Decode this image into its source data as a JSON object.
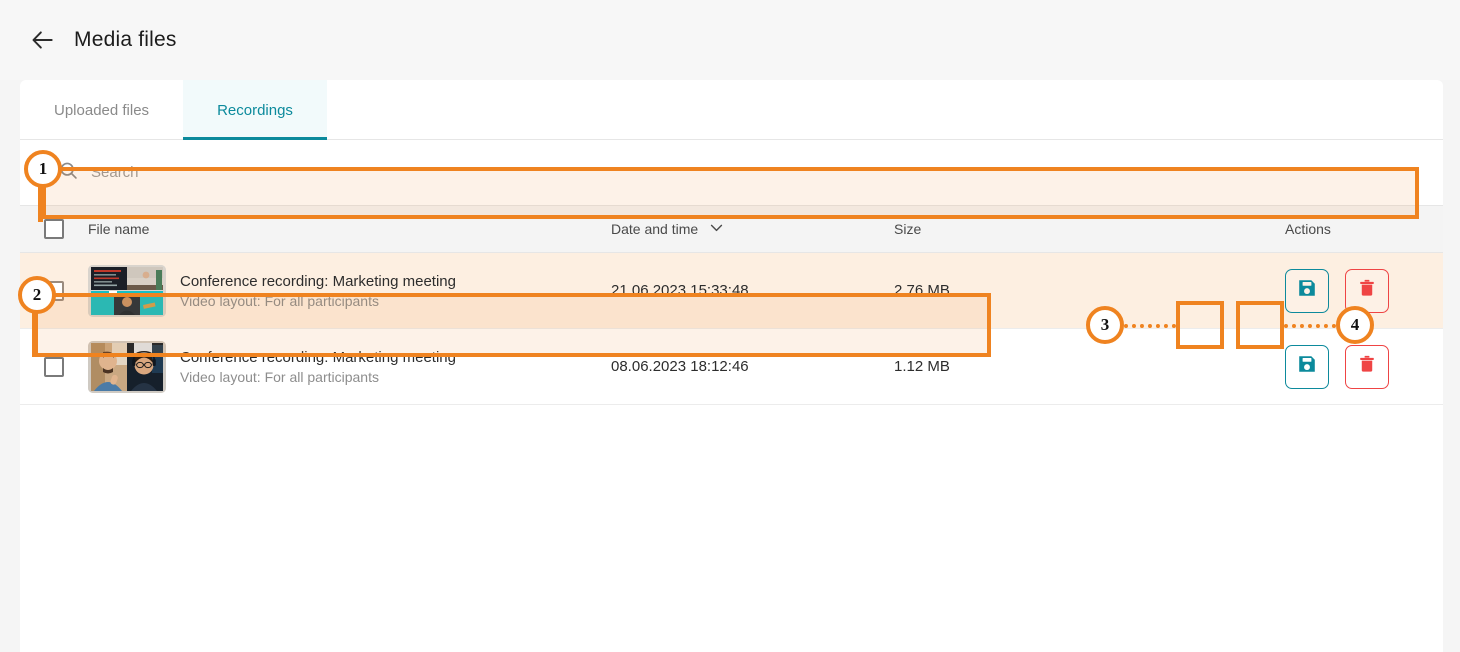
{
  "header": {
    "back_icon": "arrow-left-icon",
    "title": "Media files"
  },
  "tabs": [
    {
      "label": "Uploaded files",
      "active": false
    },
    {
      "label": "Recordings",
      "active": true
    }
  ],
  "search": {
    "icon": "search-icon",
    "placeholder": "Search",
    "value": ""
  },
  "table": {
    "columns": {
      "file_name": "File name",
      "date_time": "Date and time",
      "size": "Size",
      "actions": "Actions"
    },
    "sort_icon": "chevron-down-icon",
    "rows": [
      {
        "title": "Conference recording: Marketing meeting",
        "subtitle": "Video layout: For all participants",
        "date": "21.06.2023 15:33:48",
        "size": "2.76 MB",
        "thumbnail": "video-grid-thumbnail",
        "save_icon": "floppy-disk-save-icon",
        "delete_icon": "trash-delete-icon",
        "highlighted": true
      },
      {
        "title": "Conference recording: Marketing meeting",
        "subtitle": "Video layout: For all participants",
        "date": "08.06.2023 18:12:46",
        "size": "1.12 MB",
        "thumbnail": "two-participants-thumbnail",
        "save_icon": "floppy-disk-save-icon",
        "delete_icon": "trash-delete-icon",
        "highlighted": false
      }
    ]
  },
  "annotations": [
    {
      "number": "1",
      "target": "search-field"
    },
    {
      "number": "2",
      "target": "recording-row"
    },
    {
      "number": "3",
      "target": "save-button"
    },
    {
      "number": "4",
      "target": "delete-button"
    }
  ],
  "colors": {
    "accent_teal": "#0c8a9c",
    "annotation_orange": "#ef8320",
    "delete_red": "#ef4444",
    "highlight_bg": "#fdefe1"
  }
}
